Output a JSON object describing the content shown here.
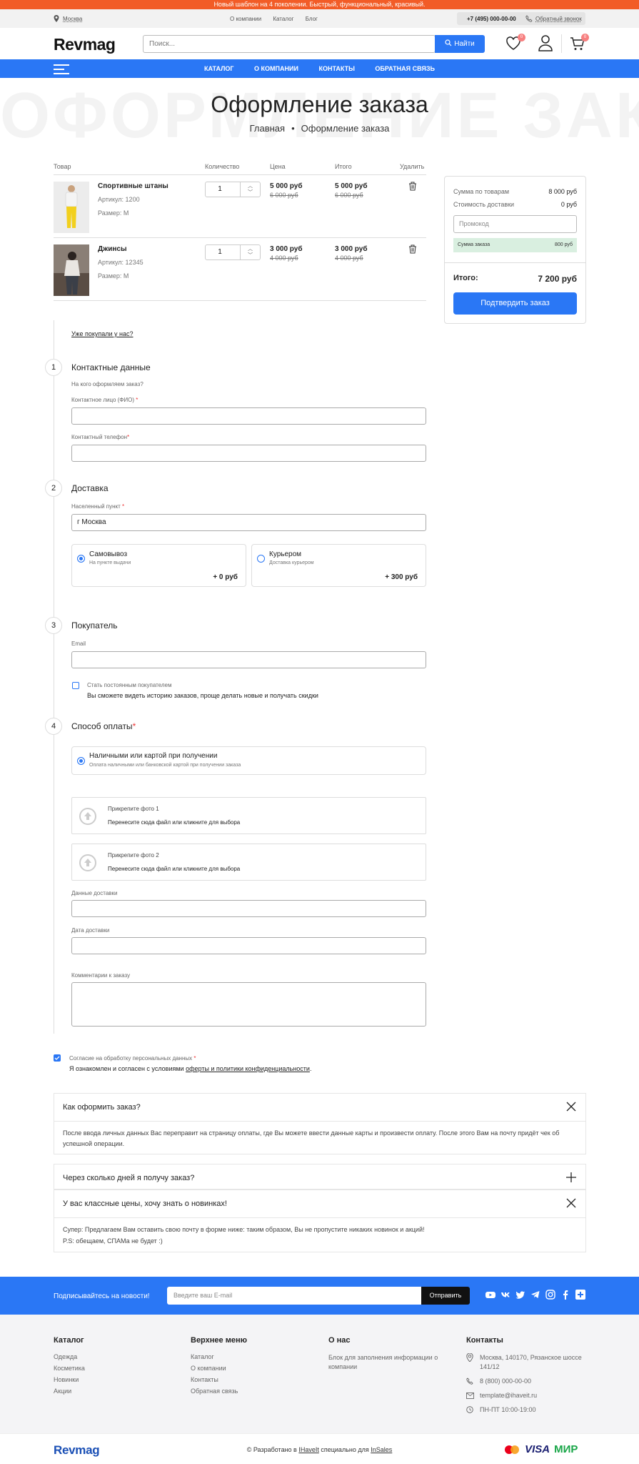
{
  "promo_bar": "Новый шаблон на 4 поколении. Быстрый, функциональный, красивый.",
  "topbar": {
    "city": "Москва",
    "menu": [
      "О компании",
      "Каталог",
      "Блог"
    ],
    "phone": "+7 (495) 000-00-00",
    "callback": "Обратный звонок"
  },
  "header": {
    "logo": "Revmag",
    "search_placeholder": "Поиск...",
    "search_button": "Найти",
    "wishlist_count": "0",
    "cart_count": "0"
  },
  "nav": [
    "КАТАЛОГ",
    "О КОМПАНИИ",
    "КОНТАКТЫ",
    "ОБРАТНАЯ СВЯЗЬ"
  ],
  "page": {
    "bg_title": "ОФОРМЛЕНИЕ ЗАКАЗА",
    "title": "Оформление заказа",
    "breadcrumb_home": "Главная",
    "breadcrumb_sep": "•",
    "breadcrumb_current": "Оформление заказа"
  },
  "cart": {
    "headers": {
      "product": "Товар",
      "qty": "Количество",
      "price": "Цена",
      "total": "Итого",
      "delete": "Удалить"
    },
    "items": [
      {
        "name": "Спортивные штаны",
        "article": "Артикул: 1200",
        "size": "Размер: M",
        "qty": "1",
        "price": "5 000 руб",
        "old_price": "6 000 руб",
        "total": "5 000 руб",
        "old_total": "6 000 руб"
      },
      {
        "name": "Джинсы",
        "article": "Артикул: 12345",
        "size": "Размер: M",
        "qty": "1",
        "price": "3 000 руб",
        "old_price": "4 000 руб",
        "total": "3 000 руб",
        "old_total": "4 000 руб"
      }
    ]
  },
  "summary": {
    "goods_label": "Сумма по товарам",
    "goods_value": "8 000 руб",
    "delivery_label": "Стоимость доставки",
    "delivery_value": "0 руб",
    "promo_placeholder": "Промокод",
    "order_label": "Сумма заказа",
    "order_value": "800 руб",
    "total_label": "Итого:",
    "total_value": "7 200 руб",
    "confirm": "Подтвердить заказ"
  },
  "form": {
    "already_bought": "Уже покупали у нас?",
    "step1": {
      "num": "1",
      "title": "Контактные данные",
      "hint": "На кого оформляем заказ?",
      "name_label": "Контактное лицо (ФИО)",
      "phone_label": "Контактный телефон"
    },
    "step2": {
      "num": "2",
      "title": "Доставка",
      "city_label": "Населенный пункт",
      "city_value": "г Москва",
      "options": [
        {
          "title": "Самовывоз",
          "sub": "На пункте выдачи",
          "price": "+ 0 руб"
        },
        {
          "title": "Курьером",
          "sub": "Доставка курьером",
          "price": "+ 300 руб"
        }
      ]
    },
    "step3": {
      "num": "3",
      "title": "Покупатель",
      "email_label": "Email",
      "regular_label": "Стать постоянным покупателем",
      "regular_desc": "Вы сможете видеть историю заказов, проще делать новые и получать скидки"
    },
    "step4": {
      "num": "4",
      "title": "Способ оплаты",
      "pay_title": "Наличными или картой при получении",
      "pay_sub": "Оплата наличными или банковской картой при получении заказа"
    },
    "upload1_title": "Прикрепите фото 1",
    "upload2_title": "Прикрепите фото 2",
    "upload_hint": "Перенесите сюда файл или кликните для выбора",
    "delivery_data_label": "Данные доставки",
    "delivery_date_label": "Дата доставки",
    "comment_label": "Комментарии к заказу",
    "required_mark": "*",
    "consent_label": "Согласие на обработку персональных данных",
    "consent_text": "Я ознакомлен и согласен с условиями",
    "consent_link": "оферты и политики конфиденциальности",
    "consent_dot": "."
  },
  "faq": [
    {
      "q": "Как оформить заказ?",
      "a": "После ввода личных данных Вас переправит на страницу оплаты, где Вы можете ввести данные карты и произвести оплату. После этого Вам на почту придёт чек об успешной операции."
    },
    {
      "q": "Через сколько дней я получу заказ?",
      "a": ""
    },
    {
      "q": "У вас классные цены, хочу знать о новинках!",
      "a": "Супер: Предлагаем Вам оставить свою почту в форме ниже: таким образом, Вы не пропустите никаких новинок и акций!",
      "a2": "P.S: обещаем, СПАМа не будет :)"
    }
  ],
  "subscribe": {
    "text": "Подписывайтесь на новости!",
    "placeholder": "Введите ваш E-mail",
    "button": "Отправить"
  },
  "footer": {
    "catalog": {
      "title": "Каталог",
      "items": [
        "Одежда",
        "Косметика",
        "Новинки",
        "Акции"
      ]
    },
    "menu": {
      "title": "Верхнее меню",
      "items": [
        "Каталог",
        "О компании",
        "Контакты",
        "Обратная связь"
      ]
    },
    "about": {
      "title": "О нас",
      "text": "Блок для заполнения информации о компании"
    },
    "contacts": {
      "title": "Контакты",
      "address": "Москва, 140170, Рязанское шоссе 141/12",
      "phone": "8 (800) 000-00-00",
      "email": "template@ihaveit.ru",
      "hours": "ПН-ПТ 10:00-19:00"
    }
  },
  "bottom": {
    "logo": "Revmag",
    "copy_prefix": "© Разработано в",
    "copy_studio": "IHaveIt",
    "copy_mid": "специально для",
    "copy_platform": "InSales",
    "visa": "VISA",
    "mir": "МИР"
  },
  "colors": {
    "accent": "#2a77f5",
    "promo": "#f25c27"
  }
}
